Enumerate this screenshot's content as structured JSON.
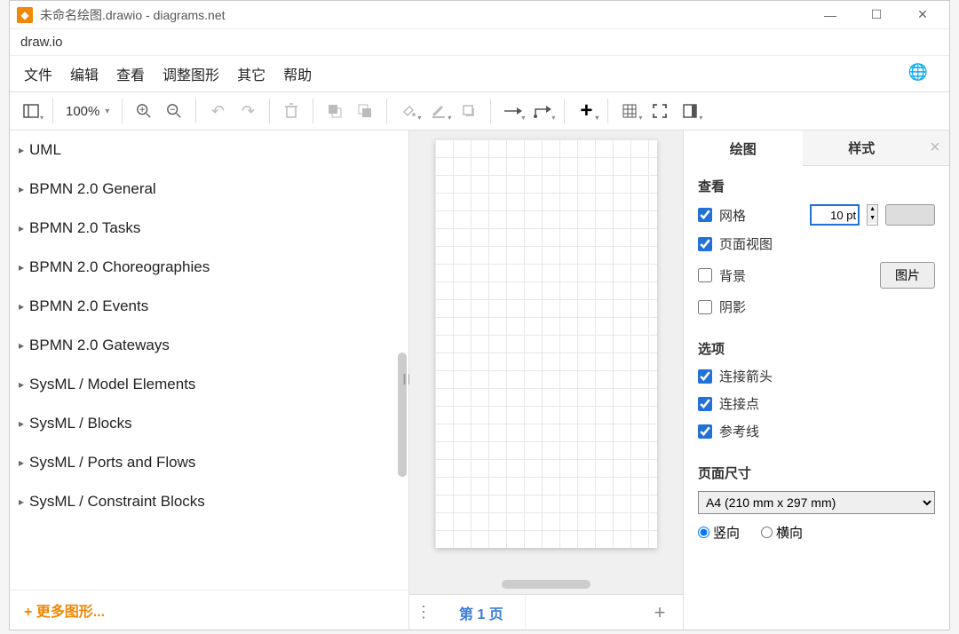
{
  "titlebar": {
    "title": "未命名绘图.drawio - diagrams.net"
  },
  "subtitle": "draw.io",
  "menu": {
    "file": "文件",
    "edit": "编辑",
    "view": "查看",
    "shape": "调整图形",
    "other": "其它",
    "help": "帮助"
  },
  "toolbar": {
    "zoom": "100%"
  },
  "shapes": [
    "UML",
    "BPMN 2.0 General",
    "BPMN 2.0 Tasks",
    "BPMN 2.0 Choreographies",
    "BPMN 2.0 Events",
    "BPMN 2.0 Gateways",
    "SysML / Model Elements",
    "SysML / Blocks",
    "SysML / Ports and Flows",
    "SysML / Constraint Blocks"
  ],
  "more_shapes": "+ 更多图形...",
  "tabs": {
    "page1": "第 1 页"
  },
  "panel": {
    "tab_draw": "绘图",
    "tab_style": "样式",
    "view_heading": "查看",
    "grid": "网格",
    "grid_value": "10 pt",
    "pageview": "页面视图",
    "background": "背景",
    "image_btn": "图片",
    "shadow": "阴影",
    "options_heading": "选项",
    "arrows": "连接箭头",
    "points": "连接点",
    "guides": "参考线",
    "pagesize_heading": "页面尺寸",
    "pagesize_value": "A4 (210 mm x 297 mm)",
    "portrait": "竖向",
    "landscape": "横向"
  }
}
